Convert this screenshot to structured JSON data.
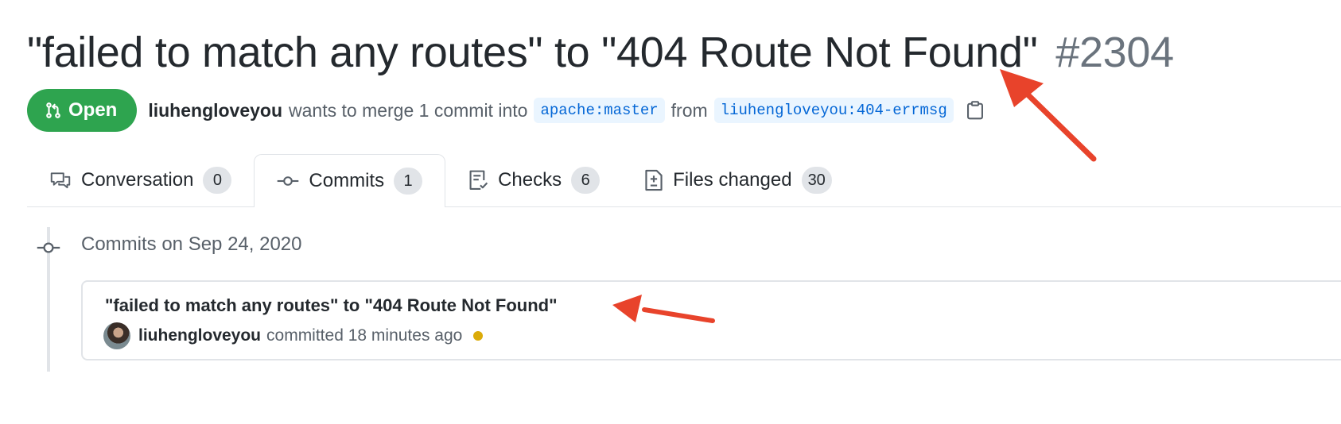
{
  "pr": {
    "title": "\"failed to match any routes\" to \"404 Route Not Found\"",
    "number": "#2304",
    "state": "Open",
    "author": "liuhengloveyou",
    "merge_text": "wants to merge 1 commit into",
    "base_branch": "apache:master",
    "from_text": "from",
    "head_branch": "liuhengloveyou:404-errmsg"
  },
  "tabs": [
    {
      "label": "Conversation",
      "count": "0",
      "icon": "comment-discussion-icon"
    },
    {
      "label": "Commits",
      "count": "1",
      "icon": "git-commit-icon",
      "selected": true
    },
    {
      "label": "Checks",
      "count": "6",
      "icon": "checklist-icon"
    },
    {
      "label": "Files changed",
      "count": "30",
      "icon": "file-diff-icon"
    }
  ],
  "timeline": {
    "day_label": "Commits on Sep 24, 2020",
    "commit": {
      "title": "\"failed to match any routes\" to \"404 Route Not Found\"",
      "author": "liuhengloveyou",
      "action": "committed",
      "time": "18 minutes ago",
      "status": "pending"
    }
  },
  "colors": {
    "open_badge": "#2ea44f",
    "branch_text": "#0366d6",
    "branch_bg": "#eaf5ff",
    "status_pending": "#dbab09",
    "annotation_arrow": "#e8432b"
  }
}
